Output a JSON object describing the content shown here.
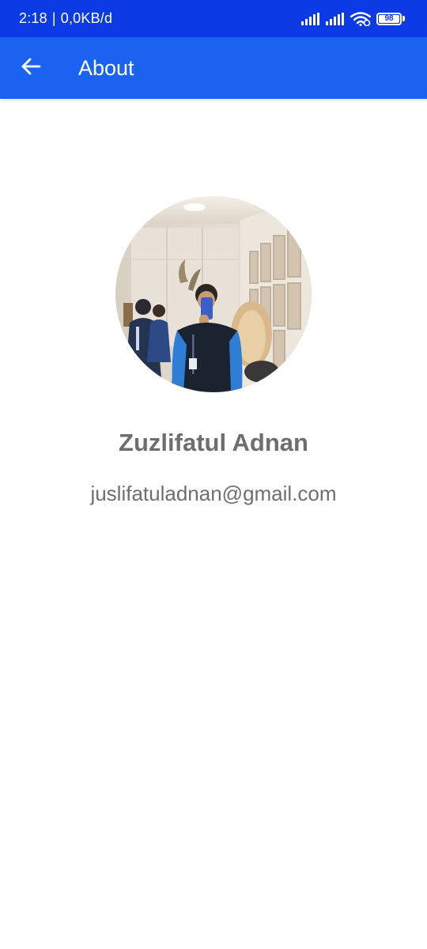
{
  "status_bar": {
    "time": "2:18",
    "separator": "|",
    "network_speed": "0,0KB/d",
    "battery_level": "98",
    "icons": [
      "signal-icon",
      "signal-icon",
      "wifi-icon",
      "battery-icon"
    ]
  },
  "app_bar": {
    "title": "About",
    "back_icon": "arrow-back-icon",
    "color": "#1a63f0"
  },
  "profile": {
    "name": "Zuzlifatul Adnan",
    "email": "juslifatuladnan@gmail.com"
  },
  "colors": {
    "status_bar": "#0c3be6",
    "app_bar": "#1a63f0",
    "text": "#6e6e6e"
  }
}
